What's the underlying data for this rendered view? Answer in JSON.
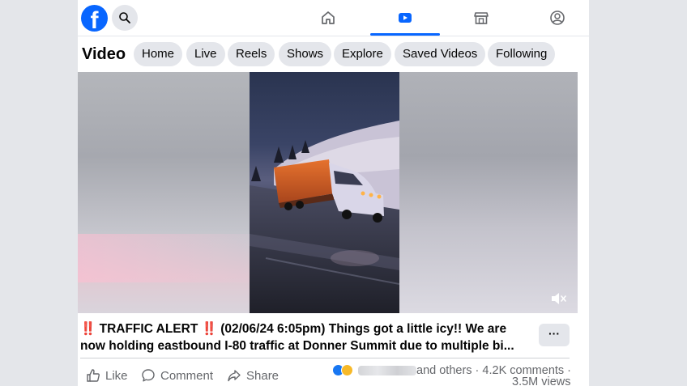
{
  "nav": {
    "logo_letter": "f",
    "icons": [
      "home-icon",
      "video-icon",
      "marketplace-icon",
      "profile-icon"
    ],
    "active_tab": "video",
    "accent_color": "#0866ff"
  },
  "section": {
    "title": "Video",
    "pills": [
      "Home",
      "Live",
      "Reels",
      "Shows",
      "Explore",
      "Saved Videos",
      "Following"
    ]
  },
  "post": {
    "text_line1": "‼️ TRAFFIC ALERT ‼️ (02/06/24 6:05pm) Things got a little icy!! We are",
    "text_line2": "now holding eastbound I-80 traffic at Donner Summit due to multiple bi...",
    "more_label": "···"
  },
  "actions": {
    "like": "Like",
    "comment": "Comment",
    "share": "Share"
  },
  "stats": {
    "reactions_others": "and others ·",
    "comments": "4.2K comments ·",
    "views": "3.5M views"
  }
}
